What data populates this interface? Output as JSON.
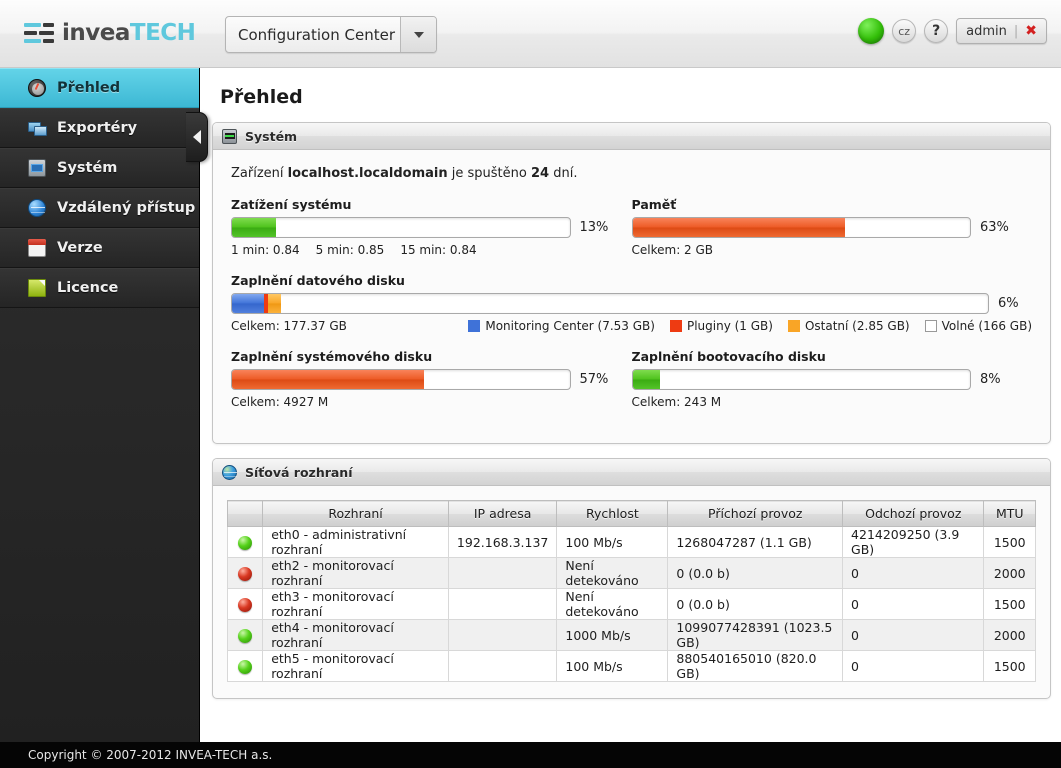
{
  "topbar": {
    "brand_first": "invea",
    "brand_second": "TECH",
    "app_selector": "Configuration Center",
    "lang_button": "cz",
    "help_button": "?",
    "user_label": "admin",
    "user_separator": "|",
    "logout_mark": "✖",
    "status_color": "#34c00a"
  },
  "sidebar": {
    "items": [
      {
        "label": "Přehled",
        "icon": "gauge-icon",
        "active": true
      },
      {
        "label": "Exportéry",
        "icon": "exporters-icon",
        "active": false
      },
      {
        "label": "Systém",
        "icon": "system-monitor-icon",
        "active": false
      },
      {
        "label": "Vzdálený přístup",
        "icon": "globe-icon",
        "active": false
      },
      {
        "label": "Verze",
        "icon": "calendar-icon",
        "active": false
      },
      {
        "label": "Licence",
        "icon": "document-icon",
        "active": false
      }
    ],
    "active_color": "#3cb8d4"
  },
  "main": {
    "page_title": "Přehled",
    "system_panel": {
      "title": "Systém",
      "device_prefix": "Zařízení ",
      "device_name": "localhost.localdomain",
      "device_middle": " je spuštěno ",
      "device_uptime": "24",
      "device_suffix": " dní.",
      "meters": {
        "load": {
          "label": "Zatížení systému",
          "percent": "13%",
          "value": 13,
          "color": "#4ec21c",
          "sub1": "1 min: 0.84",
          "sub2": "5 min: 0.85",
          "sub3": "15 min: 0.84"
        },
        "memory": {
          "label": "Paměť",
          "percent": "63%",
          "value": 63,
          "color": "#ed5a24",
          "sub": "Celkem: 2 GB"
        },
        "data_disk": {
          "label": "Zaplnění datového disku",
          "percent": "6%",
          "total": "Celkem: 177.37 GB",
          "segments": [
            {
              "name": "Monitoring Center",
              "size": "7.53 GB",
              "value": 4.25,
              "color": "#3f72d8",
              "legend": "Monitoring Center (7.53 GB)"
            },
            {
              "name": "Pluginy",
              "size": "1 GB",
              "value": 0.56,
              "color": "#ee3b12",
              "legend": "Pluginy (1 GB)"
            },
            {
              "name": "Ostatní",
              "size": "2.85 GB",
              "value": 1.61,
              "color": "#f9a526",
              "legend": "Ostatní (2.85 GB)"
            },
            {
              "name": "Volné",
              "size": "166 GB",
              "value": 93.58,
              "color": "#ffffff",
              "legend": "Volné (166 GB)"
            }
          ]
        },
        "system_disk": {
          "label": "Zaplnění systémového disku",
          "percent": "57%",
          "value": 57,
          "color": "#ed5a24",
          "sub": "Celkem: 4927 M"
        },
        "boot_disk": {
          "label": "Zaplnění bootovacího disku",
          "percent": "8%",
          "value": 8,
          "color": "#4ec21c",
          "sub": "Celkem: 243 M"
        }
      }
    },
    "network_panel": {
      "title": "Síťová rozhraní",
      "columns": [
        "",
        "Rozhraní",
        "IP adresa",
        "Rychlost",
        "Příchozí provoz",
        "Odchozí provoz",
        "MTU"
      ],
      "rows": [
        {
          "status": "up",
          "name": "eth0 - administrativní rozhraní",
          "ip": "192.168.3.137",
          "speed": "100 Mb/s",
          "rx": "1268047287 (1.1 GB)",
          "tx": "4214209250 (3.9 GB)",
          "mtu": "1500"
        },
        {
          "status": "down",
          "name": "eth2 - monitorovací rozhraní",
          "ip": "",
          "speed": "Není detekováno",
          "rx": "0 (0.0 b)",
          "tx": "0",
          "mtu": "2000"
        },
        {
          "status": "down",
          "name": "eth3 - monitorovací rozhraní",
          "ip": "",
          "speed": "Není detekováno",
          "rx": "0 (0.0 b)",
          "tx": "0",
          "mtu": "1500"
        },
        {
          "status": "up",
          "name": "eth4 - monitorovací rozhraní",
          "ip": "",
          "speed": "1000 Mb/s",
          "rx": "1099077428391 (1023.5 GB)",
          "tx": "0",
          "mtu": "2000"
        },
        {
          "status": "up",
          "name": "eth5 - monitorovací rozhraní",
          "ip": "",
          "speed": "100 Mb/s",
          "rx": "880540165010 (820.0 GB)",
          "tx": "0",
          "mtu": "1500"
        }
      ]
    }
  },
  "footer": {
    "copyright": "Copyright © 2007-2012 INVEA-TECH a.s."
  }
}
